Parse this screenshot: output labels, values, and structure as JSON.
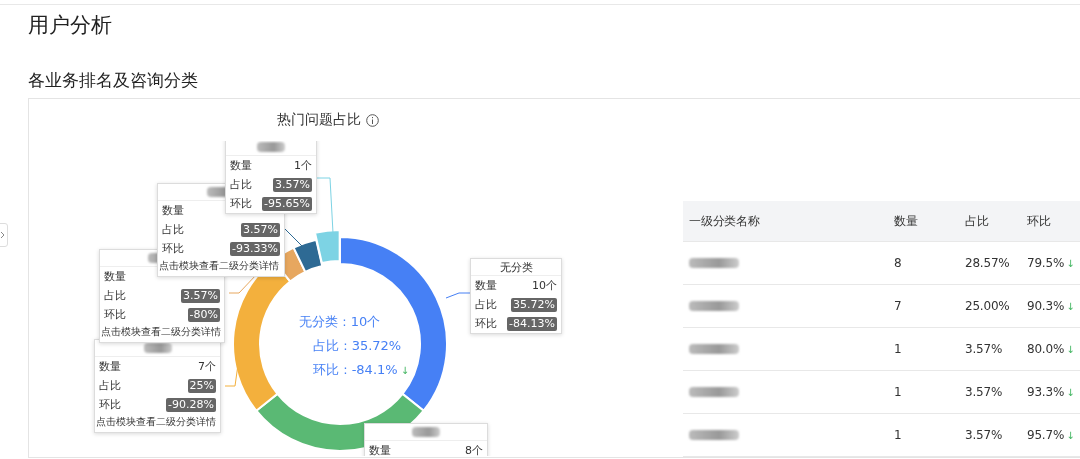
{
  "page_title": "用户分析",
  "section_title": "各业务排名及咨询分类",
  "panel": {
    "title": "热门问题占比",
    "chart_data": {
      "type": "donut",
      "values": [
        35.72,
        28.57,
        25,
        3.57,
        3.57,
        3.57
      ],
      "colors": [
        "#4680f5",
        "#5ab974",
        "#f3b03d",
        "#e7a75f",
        "#2e6a94",
        "#7dd3e4"
      ]
    },
    "center": [
      {
        "text": "无分类 : 10个"
      },
      {
        "text": "占比 : 35.72%"
      },
      {
        "text": "环比 : -84.1%",
        "arrow": "↓"
      }
    ],
    "tooltips": [
      {
        "rows": [
          {
            "label": "数量",
            "value": "1个",
            "kind": "plain"
          },
          {
            "label": "占比",
            "value": "3.57%",
            "kind": "tag"
          },
          {
            "label": "环比",
            "value": "-95.65%",
            "kind": "tag"
          }
        ]
      },
      {
        "rows": [
          {
            "label": "数量",
            "kind": "plain"
          },
          {
            "label": "占比",
            "value": "3.57%",
            "kind": "tag"
          },
          {
            "label": "环比",
            "value": "-93.33%",
            "kind": "tag"
          }
        ],
        "footer": "点击模块查看二级分类详情"
      },
      {
        "rows": [
          {
            "label": "数量",
            "kind": "plain"
          },
          {
            "label": "占比",
            "value": "3.57%",
            "kind": "tag"
          },
          {
            "label": "环比",
            "value": "-80%",
            "kind": "tag"
          }
        ],
        "footer": "点击模块查看二级分类详情"
      },
      {
        "rows": [
          {
            "label": "数量",
            "value": "7个",
            "kind": "plain"
          },
          {
            "label": "占比",
            "value": "25%",
            "kind": "tag"
          },
          {
            "label": "环比",
            "value": "-90.28%",
            "kind": "tag"
          }
        ],
        "footer": "点击模块查看二级分类详情"
      },
      {
        "title": "无分类",
        "rows": [
          {
            "label": "数量",
            "value": "10个",
            "kind": "plain"
          },
          {
            "label": "占比",
            "value": "35.72%",
            "kind": "tag"
          },
          {
            "label": "环比",
            "value": "-84.13%",
            "kind": "tag"
          }
        ]
      },
      {
        "rows": [
          {
            "label": "数量",
            "value": "8个",
            "kind": "plain"
          }
        ]
      }
    ],
    "table": {
      "columns": [
        "一级分类名称",
        "数量",
        "占比",
        "环比"
      ],
      "rows": [
        {
          "count": "8",
          "share": "28.57%",
          "change": "79.5%",
          "arrow": "↓"
        },
        {
          "count": "7",
          "share": "25.00%",
          "change": "90.3%",
          "arrow": "↓"
        },
        {
          "count": "1",
          "share": "3.57%",
          "change": "80.0%",
          "arrow": "↓"
        },
        {
          "count": "1",
          "share": "3.57%",
          "change": "93.3%",
          "arrow": "↓"
        },
        {
          "count": "1",
          "share": "3.57%",
          "change": "95.7%",
          "arrow": "↓"
        }
      ]
    }
  }
}
